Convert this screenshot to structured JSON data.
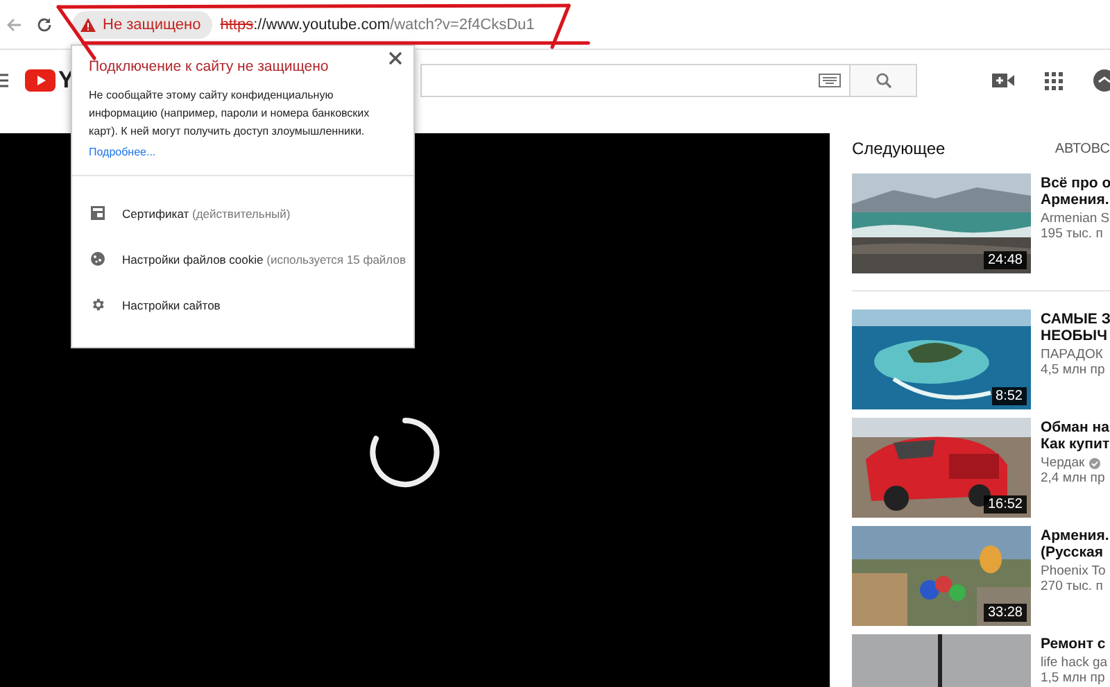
{
  "browser": {
    "security_label": "Не защищено",
    "url": {
      "scheme": "https",
      "host": "://www.youtube.com",
      "path": "/watch?v=2f4CksDu1"
    }
  },
  "youtube_header": {
    "logo_text": "Y"
  },
  "site_info_popup": {
    "title": "Подключение к сайту не защищено",
    "message": "Не сообщайте этому сайту конфиденциальную информацию (например, пароли и номера банковских карт). К ней могут получить доступ злоумышленники.",
    "link": "Подробнее...",
    "items": [
      {
        "kind": "certificate",
        "label": "Сертификат",
        "note": "(действительный)"
      },
      {
        "kind": "cookies",
        "label": "Настройки файлов cookie",
        "note": "(используется 15 файлов"
      },
      {
        "kind": "settings",
        "label": "Настройки сайтов"
      }
    ]
  },
  "up_next": {
    "heading": "Следующее",
    "autoplay_label": "АВТОВС",
    "videos": [
      {
        "duration": "24:48",
        "title": [
          "Всё про о",
          "Армения."
        ],
        "channel": "Armenian S",
        "verified": false,
        "views": "195 тыс. п"
      },
      {
        "duration": "8:52",
        "title": [
          "САМЫЕ З",
          "НЕОБЫЧ"
        ],
        "channel": "ПАРАДОК",
        "verified": false,
        "views": "4,5 млн пр"
      },
      {
        "duration": "16:52",
        "title": [
          "Обман на",
          "Как купит"
        ],
        "channel": "Чердак",
        "verified": true,
        "views": "2,4 млн пр"
      },
      {
        "duration": "33:28",
        "title": [
          "Армения.",
          "(Русская"
        ],
        "channel": "Phoenix To",
        "verified": false,
        "views": "270 тыс. п"
      },
      {
        "title": [
          "Ремонт с"
        ],
        "channel": "life hack ga",
        "verified": false,
        "views": "1,5 млн пр"
      }
    ]
  }
}
